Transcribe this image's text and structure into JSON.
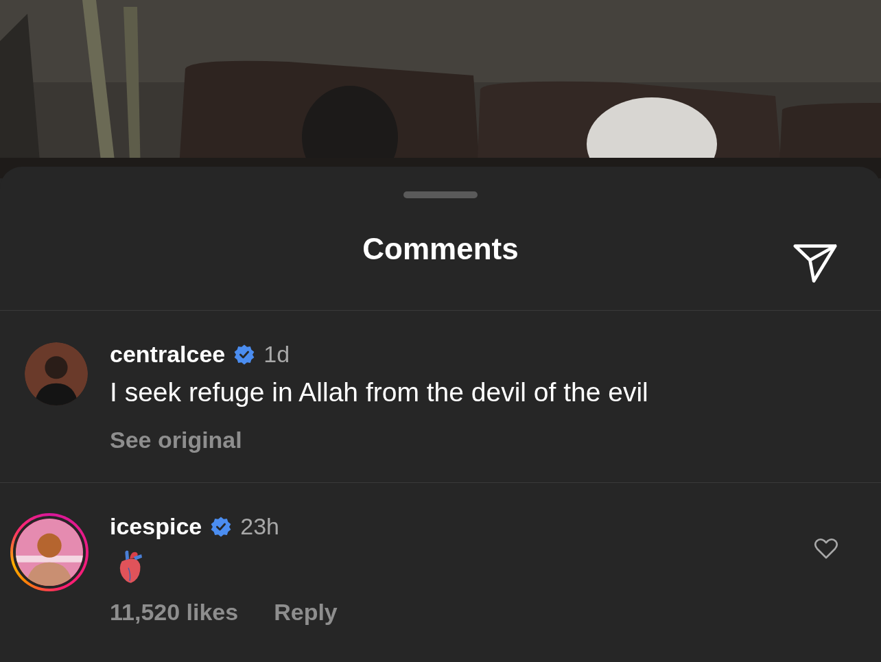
{
  "sheet": {
    "title": "Comments"
  },
  "comments": [
    {
      "kind": "translated",
      "username": "centralcee",
      "verified": true,
      "time": "1d",
      "text": "I seek refuge in Allah from the devil of the evil",
      "see_original": "See original",
      "story_ring": false
    },
    {
      "kind": "reaction",
      "username": "icespice",
      "verified": true,
      "time": "23h",
      "likes": "11,520 likes",
      "reply": "Reply",
      "story_ring": true,
      "liked": false
    }
  ]
}
